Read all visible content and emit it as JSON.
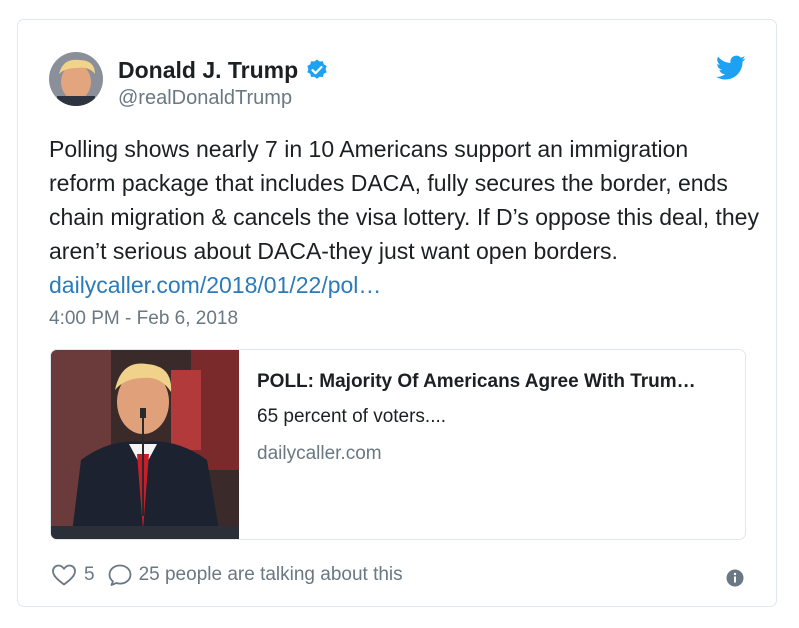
{
  "author": {
    "display_name": "Donald J. Trump",
    "handle": "@realDonaldTrump",
    "verified_icon": "verified-badge-icon",
    "avatar_icon": "avatar"
  },
  "brand": {
    "icon": "twitter-bird-icon",
    "color": "#1da1f2"
  },
  "tweet": {
    "text": "Polling shows nearly 7 in 10 Americans support an immigration reform package that includes DACA, fully secures the border, ends chain migration & cancels the visa lottery. If D’s oppose this deal, they aren’t serious about DACA-they just want open borders. ",
    "link_text": "dailycaller.com/2018/01/22/pol…",
    "timestamp": "4:00 PM - Feb 6, 2018",
    "link_color": "#2b7bb9"
  },
  "link_card": {
    "title": "POLL: Majority Of Americans Agree With Trum…",
    "description": "65 percent of voters....",
    "domain": "dailycaller.com"
  },
  "actions": {
    "like_count": "5",
    "talking_text": "25 people are talking about this",
    "like_icon": "heart-icon",
    "reply_icon": "reply-bubble-icon",
    "info_icon": "info-icon"
  },
  "colors": {
    "secondary_text": "#697882",
    "border": "#e1e8ed"
  }
}
